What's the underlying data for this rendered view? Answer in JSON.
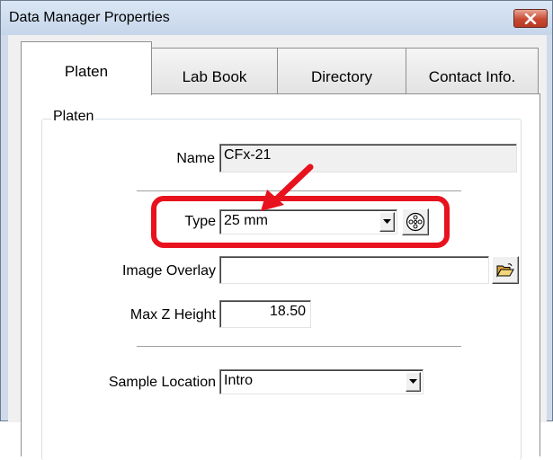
{
  "window": {
    "title": "Data Manager Properties",
    "close_icon": "close-icon"
  },
  "tabs": [
    {
      "label": "Platen",
      "active": true
    },
    {
      "label": "Lab Book",
      "active": false
    },
    {
      "label": "Directory",
      "active": false
    },
    {
      "label": "Contact Info.",
      "active": false
    }
  ],
  "platen": {
    "group_label": "Platen",
    "name_label": "Name",
    "name_value": "CFx-21",
    "type_label": "Type",
    "type_value": "25 mm",
    "platen_icon": "platen-pattern-icon",
    "image_overlay_label": "Image Overlay",
    "image_overlay_value": "",
    "folder_icon": "open-folder-icon",
    "max_z_label": "Max Z Height",
    "max_z_value": "18.50",
    "sample_location_label": "Sample Location",
    "sample_location_value": "Intro"
  },
  "annotation": {
    "highlight_color": "#e8121e"
  }
}
